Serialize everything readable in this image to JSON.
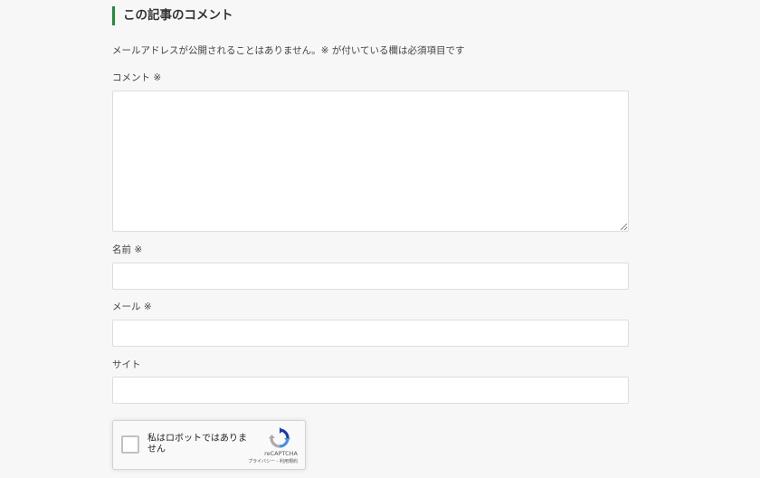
{
  "section": {
    "title": "この記事のコメント",
    "notice": "メールアドレスが公開されることはありません。※ が付いている欄は必須項目です"
  },
  "fields": {
    "comment_label": "コメント ※",
    "name_label": "名前 ※",
    "email_label": "メール ※",
    "site_label": "サイト"
  },
  "recaptcha": {
    "checkbox_label": "私はロボットではありません",
    "brand": "reCAPTCHA",
    "terms": "プライバシー - 利用規約"
  },
  "colors": {
    "accent": "#1f8f3a",
    "background": "#f7f7f7"
  }
}
